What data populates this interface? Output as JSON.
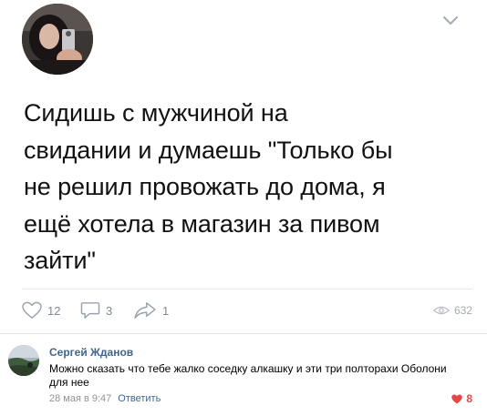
{
  "post": {
    "text": "Сидишь с мужчиной на\nсвидании и думаешь \"Только бы\nне решил провожать до дома, я\nещё хотела в магазин за пивом\nзайти\"",
    "likes": "12",
    "comments": "3",
    "shares": "1",
    "views": "632",
    "icons": [
      "avatar-photo",
      "chevron-down-icon",
      "heart-icon",
      "comment-icon",
      "share-icon",
      "eye-icon"
    ]
  },
  "comment": {
    "author": "Сергей Жданов",
    "text": "Можно сказать что тебе жалко соседку алкашку и эти три полторахи Оболони для нее",
    "date": "28 мая в 9:47",
    "reply_label": "Ответить",
    "likes": "8"
  },
  "colors": {
    "link": "#42648b",
    "icon_gray": "#99a2ad",
    "like_red": "#e64646"
  }
}
